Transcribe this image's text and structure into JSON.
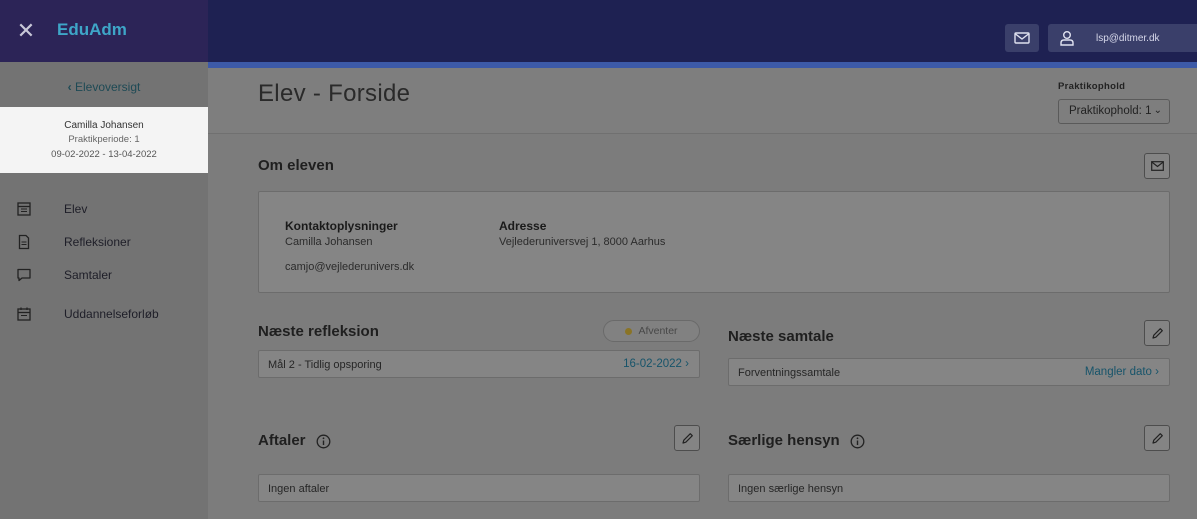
{
  "app": {
    "title": "EduAdm",
    "user_email": "lsp@ditmer.dk"
  },
  "sidebar": {
    "back_label": "Elevoversigt",
    "student": {
      "name": "Camilla Johansen",
      "period": "Praktikperiode: 1",
      "dates": "09-02-2022 - 13-04-2022"
    },
    "items": [
      {
        "label": "Elev",
        "icon": "calendar-grid-icon"
      },
      {
        "label": "Refleksioner",
        "icon": "document-icon"
      },
      {
        "label": "Samtaler",
        "icon": "chat-bubble-icon"
      },
      {
        "label": "Uddannelseforløb",
        "icon": "calendar-icon"
      }
    ]
  },
  "header": {
    "page_title": "Elev - Forside",
    "praktik_label": "Praktikophold",
    "praktik_value": "Praktikophold: 1"
  },
  "om_eleven": {
    "title": "Om eleven",
    "contact_label": "Kontaktoplysninger",
    "contact_name": "Camilla Johansen",
    "contact_email": "camjo@vejlederunivers.dk",
    "address_label": "Adresse",
    "address_value": "Vejlederuniversvej 1, 8000 Aarhus"
  },
  "naeste_refleksion": {
    "title": "Næste refleksion",
    "status": "Afventer",
    "item_label": "Mål 2 - Tidlig opsporing",
    "item_date": "16-02-2022"
  },
  "naeste_samtale": {
    "title": "Næste samtale",
    "item_label": "Forventningssamtale",
    "item_status": "Mangler dato"
  },
  "aftaler": {
    "title": "Aftaler",
    "empty": "Ingen aftaler"
  },
  "saerlige_hensyn": {
    "title": "Særlige hensyn",
    "empty": "Ingen særlige hensyn"
  },
  "colors": {
    "topbar": "#1e2152",
    "accent": "#3ea6c8",
    "link": "#17546a"
  }
}
